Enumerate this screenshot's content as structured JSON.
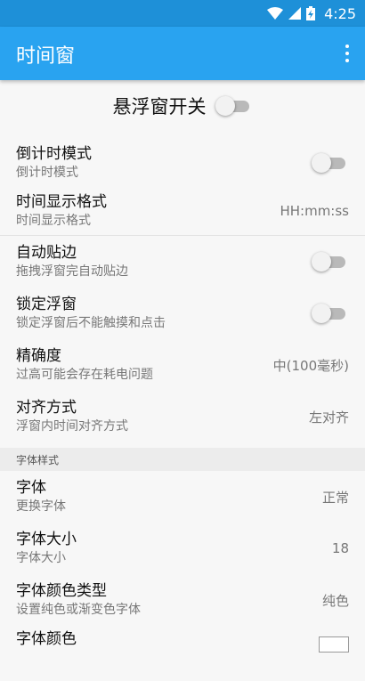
{
  "status_bar": {
    "time": "4:25",
    "wifi_icon": "wifi-icon",
    "signal_icon": "signal-icon",
    "battery_icon": "battery-charging-icon"
  },
  "app_bar": {
    "title": "时间窗",
    "menu_icon": "more-vert-icon"
  },
  "master_switch": {
    "label": "悬浮窗开关",
    "on": false
  },
  "settings": [
    {
      "title": "倒计时模式",
      "summary": "倒计时模式",
      "type": "switch",
      "on": false
    },
    {
      "title": "时间显示格式",
      "summary": "时间显示格式",
      "type": "value",
      "value": "HH:mm:ss"
    },
    {
      "title": "自动贴边",
      "summary": "拖拽浮窗完自动贴边",
      "type": "switch",
      "on": false
    },
    {
      "title": "锁定浮窗",
      "summary": "锁定浮窗后不能触摸和点击",
      "type": "switch",
      "on": false
    },
    {
      "title": "精确度",
      "summary": "过高可能会存在耗电问题",
      "type": "value",
      "value": "中(100毫秒)"
    },
    {
      "title": "对齐方式",
      "summary": "浮窗内时间对齐方式",
      "type": "value",
      "value": "左对齐"
    }
  ],
  "font_section": {
    "header": "字体样式",
    "items": [
      {
        "title": "字体",
        "summary": "更换字体",
        "type": "value",
        "value": "正常"
      },
      {
        "title": "字体大小",
        "summary": "字体大小",
        "type": "value",
        "value": "18"
      },
      {
        "title": "字体颜色类型",
        "summary": "设置纯色或渐变色字体",
        "type": "value",
        "value": "纯色"
      },
      {
        "title": "字体颜色",
        "type": "swatch",
        "color": "#ffffff"
      }
    ]
  },
  "colors": {
    "status_bar": "#1e90d8",
    "app_bar": "#29a3f0",
    "background": "#f7f7f7"
  }
}
